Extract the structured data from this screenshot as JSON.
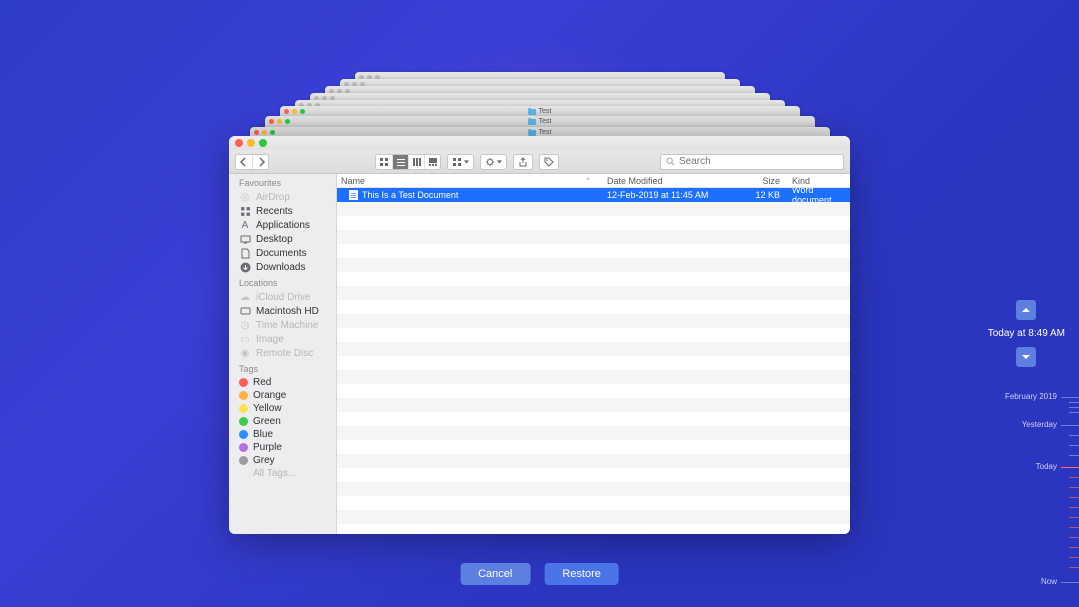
{
  "stacked_window_title": "Test",
  "snapshot_time": "Today at 8:49 AM",
  "timeline": {
    "month": "February 2019",
    "yesterday": "Yesterday",
    "today": "Today",
    "now": "Now"
  },
  "buttons": {
    "cancel": "Cancel",
    "restore": "Restore"
  },
  "search": {
    "placeholder": "Search"
  },
  "columns": {
    "name": "Name",
    "date": "Date Modified",
    "size": "Size",
    "kind": "Kind"
  },
  "file": {
    "name": "This Is a Test Document",
    "date": "12-Feb-2019 at 11:45 AM",
    "size": "12 KB",
    "kind": "Word document"
  },
  "sidebar": {
    "favourites_hdr": "Favourites",
    "favourites": [
      {
        "label": "AirDrop",
        "dim": true
      },
      {
        "label": "Recents",
        "dim": false
      },
      {
        "label": "Applications",
        "dim": false
      },
      {
        "label": "Desktop",
        "dim": false
      },
      {
        "label": "Documents",
        "dim": false
      },
      {
        "label": "Downloads",
        "dim": false
      }
    ],
    "locations_hdr": "Locations",
    "locations": [
      {
        "label": "iCloud Drive",
        "dim": true
      },
      {
        "label": "Macintosh HD",
        "dim": false
      },
      {
        "label": "Time Machine",
        "dim": true
      },
      {
        "label": "Image",
        "dim": true
      },
      {
        "label": "Remote Disc",
        "dim": true
      }
    ],
    "tags_hdr": "Tags",
    "tags": [
      {
        "label": "Red",
        "cls": "tag-red"
      },
      {
        "label": "Orange",
        "cls": "tag-orange"
      },
      {
        "label": "Yellow",
        "cls": "tag-yellow"
      },
      {
        "label": "Green",
        "cls": "tag-green"
      },
      {
        "label": "Blue",
        "cls": "tag-blue"
      },
      {
        "label": "Purple",
        "cls": "tag-purple"
      },
      {
        "label": "Grey",
        "cls": "tag-grey"
      }
    ],
    "all_tags": "All Tags..."
  }
}
